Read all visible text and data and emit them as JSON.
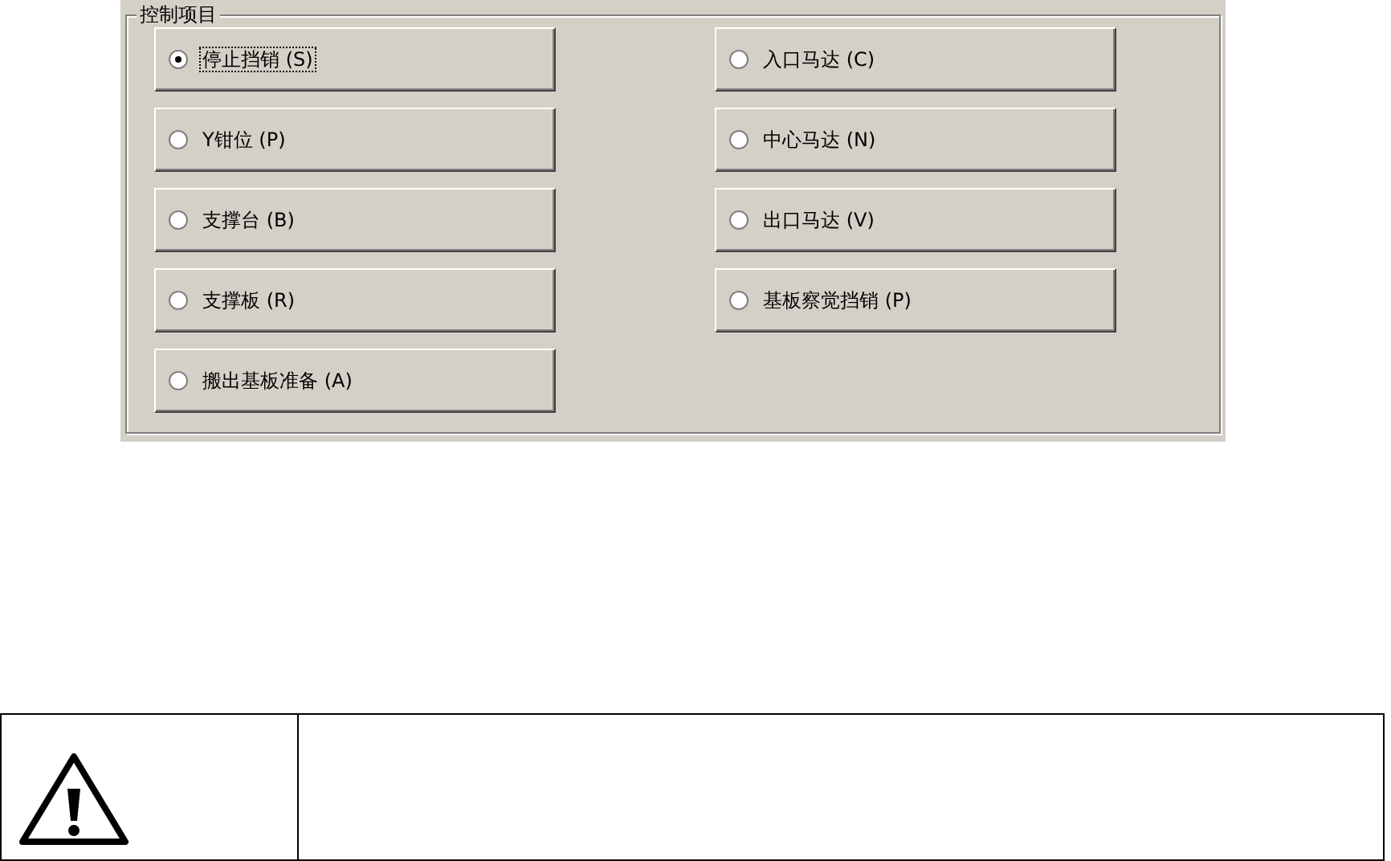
{
  "group": {
    "title": "控制项目",
    "options": [
      {
        "label": "停止挡销 (S)",
        "selected": true
      },
      {
        "label": "入口马达 (C)",
        "selected": false
      },
      {
        "label": "Y钳位 (P)",
        "selected": false
      },
      {
        "label": "中心马达 (N)",
        "selected": false
      },
      {
        "label": "支撑台 (B)",
        "selected": false
      },
      {
        "label": "出口马达 (V)",
        "selected": false
      },
      {
        "label": "支撑板 (R)",
        "selected": false
      },
      {
        "label": "基板察觉挡销 (P)",
        "selected": false
      },
      {
        "label": "搬出基板准备 (A)",
        "selected": false
      }
    ]
  }
}
